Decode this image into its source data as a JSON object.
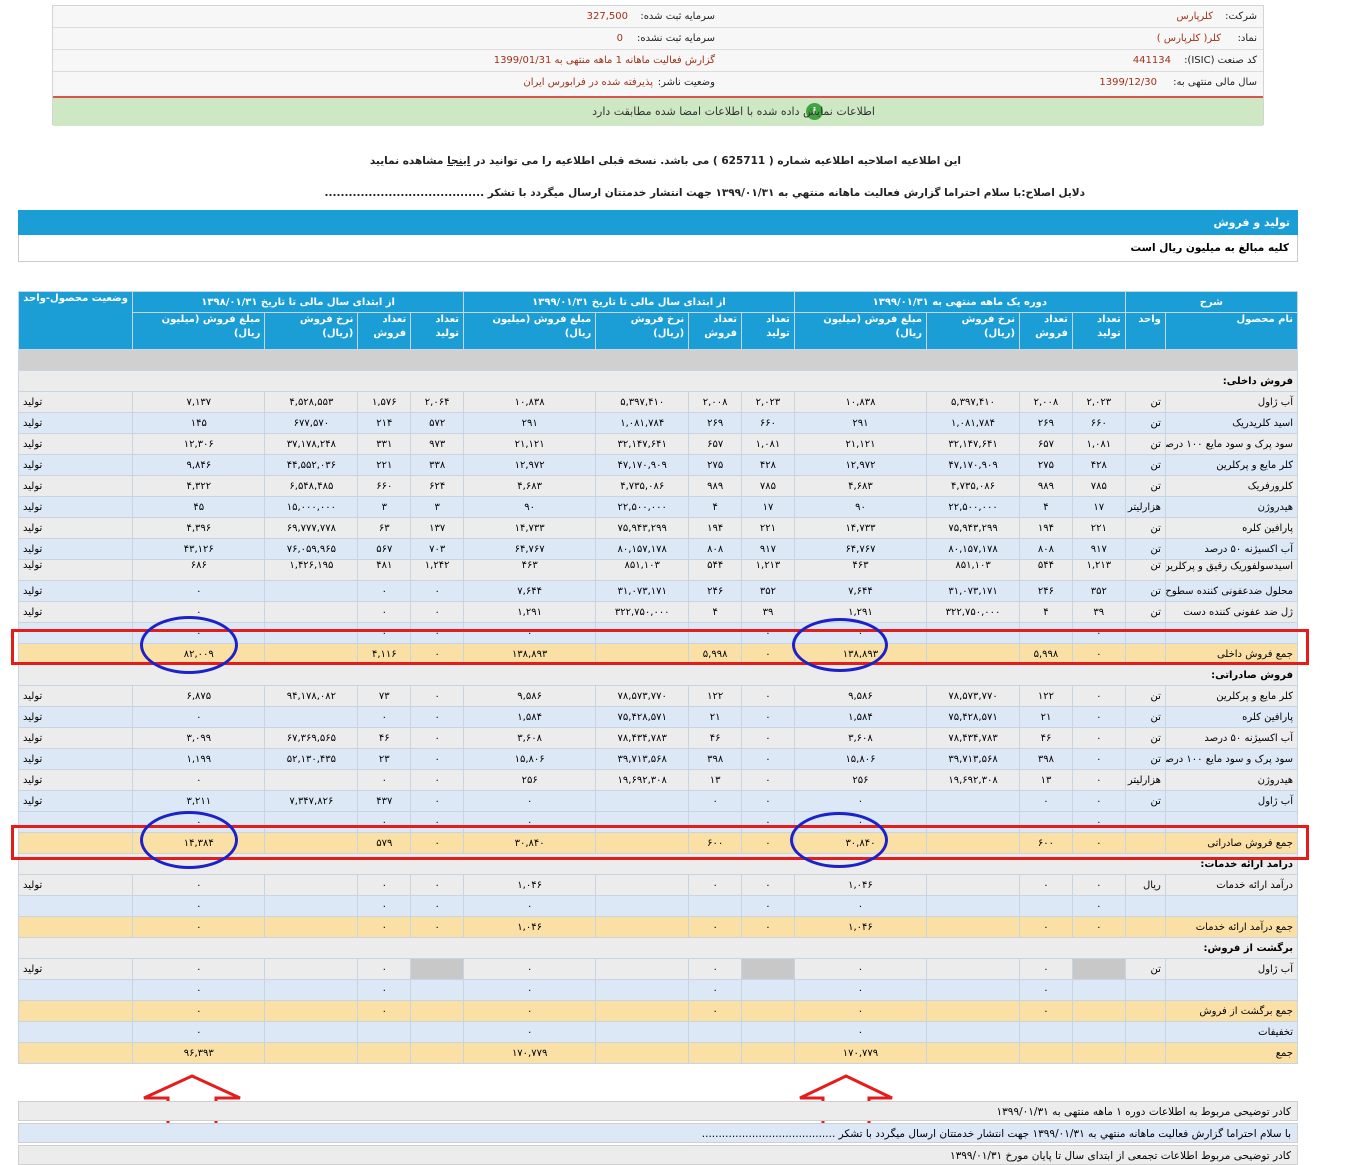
{
  "company_info": {
    "company_label": "شرکت:",
    "company_value": "کلرپارس",
    "symbol_label": "نماد:",
    "symbol_value": "کلر( کلرپارس )",
    "isic_label": "کد صنعت (ISIC):",
    "isic_value": "441134",
    "fiscal_label": "سال مالی منتهی به:",
    "fiscal_value": "1399/12/30",
    "capital_reg_label": "سرمایه ثبت شده:",
    "capital_reg_value": "327,500",
    "capital_unreg_label": "سرمایه ثبت نشده:",
    "capital_unreg_value": "0",
    "report_label": "گزارش فعالیت ماهانه 1 ماهه منتهی به 1399/01/31",
    "publisher_label": "وضعیت ناشر:",
    "publisher_value": "پذیرفته شده در فرابورس ایران",
    "notice_icon": "info-icon",
    "notice_text": "اطلاعات نمایش داده شده با اطلاعات امضا شده مطابقت دارد"
  },
  "correction": {
    "line1_pre": "این اطلاعیه اصلاحیه اطلاعیه شماره ( 625711 ) می باشد. نسخه قبلی اطلاعیه را می توانید در",
    "line1_link": "اینجا",
    "line1_post": "مشاهده نمایید",
    "line2": "دلایل اصلاح:با سلام احتراما گزارش فعالیت ماهانه منتهي به ۱۳۹۹/۰۱/۳۱ جهت انتشار خدمتتان ارسال میگردد با تشکر ........................................"
  },
  "section": {
    "title": "تولید و فروش",
    "subtitle": "کلیه مبالغ به میلیون ریال است"
  },
  "table_header": {
    "desc": "شرح",
    "period1": "دوره یک ماهه منتهی به ۱۳۹۹/۰۱/۳۱",
    "period2": "از ابتدای سال مالی تا تاریخ ۱۳۹۹/۰۱/۳۱",
    "period3": "از ابتدای سال مالی تا تاریخ ۱۳۹۸/۰۱/۳۱",
    "status": "وضعیت محصول-واحد",
    "product": "نام محصول",
    "unit": "واحد",
    "prod_qty": "تعداد تولید",
    "sale_qty": "تعداد فروش",
    "rate": "نرخ فروش (ریال)",
    "amount": "مبلغ فروش (میلیون ریال)"
  },
  "rows": [
    {
      "type": "spacer"
    },
    {
      "type": "section",
      "name": "فروش داخلی:"
    },
    {
      "type": "data",
      "name": "آب ژاول",
      "unit": "تن",
      "c": [
        "۲,۰۲۳",
        "۲,۰۰۸",
        "۵,۳۹۷,۴۱۰",
        "۱۰,۸۳۸",
        "۲,۰۲۳",
        "۲,۰۰۸",
        "۵,۳۹۷,۴۱۰",
        "۱۰,۸۳۸",
        "۲,۰۶۴",
        "۱,۵۷۶",
        "۴,۵۲۸,۵۵۳",
        "۷,۱۳۷"
      ],
      "status": "تولید"
    },
    {
      "type": "data",
      "name": "اسید کلریدریک",
      "unit": "تن",
      "c": [
        "۶۶۰",
        "۲۶۹",
        "۱,۰۸۱,۷۸۴",
        "۲۹۱",
        "۶۶۰",
        "۲۶۹",
        "۱,۰۸۱,۷۸۴",
        "۲۹۱",
        "۵۷۲",
        "۲۱۴",
        "۶۷۷,۵۷۰",
        "۱۴۵"
      ],
      "status": "تولید"
    },
    {
      "type": "data",
      "name": "سود پرک و سود مایع ۱۰۰ درصد",
      "unit": "تن",
      "c": [
        "۱,۰۸۱",
        "۶۵۷",
        "۳۲,۱۴۷,۶۴۱",
        "۲۱,۱۲۱",
        "۱,۰۸۱",
        "۶۵۷",
        "۳۲,۱۴۷,۶۴۱",
        "۲۱,۱۲۱",
        "۹۷۳",
        "۳۳۱",
        "۳۷,۱۷۸,۲۴۸",
        "۱۲,۳۰۶"
      ],
      "status": "تولید"
    },
    {
      "type": "data",
      "name": "کلر مایع و پرکلرین",
      "unit": "تن",
      "c": [
        "۴۲۸",
        "۲۷۵",
        "۴۷,۱۷۰,۹۰۹",
        "۱۲,۹۷۲",
        "۴۲۸",
        "۲۷۵",
        "۴۷,۱۷۰,۹۰۹",
        "۱۲,۹۷۲",
        "۳۳۸",
        "۲۲۱",
        "۴۴,۵۵۲,۰۳۶",
        "۹,۸۴۶"
      ],
      "status": "تولید"
    },
    {
      "type": "data",
      "name": "کلرورفریک",
      "unit": "تن",
      "c": [
        "۷۸۵",
        "۹۸۹",
        "۴,۷۳۵,۰۸۶",
        "۴,۶۸۳",
        "۷۸۵",
        "۹۸۹",
        "۴,۷۳۵,۰۸۶",
        "۴,۶۸۳",
        "۶۲۴",
        "۶۶۰",
        "۶,۵۴۸,۴۸۵",
        "۴,۳۲۲"
      ],
      "status": "تولید"
    },
    {
      "type": "data",
      "name": "هیدروژن",
      "unit": "هزارلیتر",
      "c": [
        "۱۷",
        "۴",
        "۲۲,۵۰۰,۰۰۰",
        "۹۰",
        "۱۷",
        "۴",
        "۲۲,۵۰۰,۰۰۰",
        "۹۰",
        "۳",
        "۳",
        "۱۵,۰۰۰,۰۰۰",
        "۴۵"
      ],
      "status": "تولید"
    },
    {
      "type": "data",
      "name": "پارافین کلره",
      "unit": "تن",
      "c": [
        "۲۲۱",
        "۱۹۴",
        "۷۵,۹۴۳,۲۹۹",
        "۱۴,۷۳۳",
        "۲۲۱",
        "۱۹۴",
        "۷۵,۹۴۳,۲۹۹",
        "۱۴,۷۳۳",
        "۱۳۷",
        "۶۳",
        "۶۹,۷۷۷,۷۷۸",
        "۴,۳۹۶"
      ],
      "status": "تولید"
    },
    {
      "type": "data",
      "name": "آب اکسیژنه ۵۰ درصد",
      "unit": "تن",
      "c": [
        "۹۱۷",
        "۸۰۸",
        "۸۰,۱۵۷,۱۷۸",
        "۶۴,۷۶۷",
        "۹۱۷",
        "۸۰۸",
        "۸۰,۱۵۷,۱۷۸",
        "۶۴,۷۶۷",
        "۷۰۳",
        "۵۶۷",
        "۷۶,۰۵۹,۹۶۵",
        "۴۳,۱۲۶"
      ],
      "status": "تولید"
    },
    {
      "type": "data",
      "tall": true,
      "name": "اسیدسولفوریک رقیق و پرکلرین مایع",
      "unit": "تن",
      "c": [
        "۱,۲۱۳",
        "۵۴۴",
        "۸۵۱,۱۰۳",
        "۴۶۳",
        "۱,۲۱۳",
        "۵۴۴",
        "۸۵۱,۱۰۳",
        "۴۶۳",
        "۱,۲۴۲",
        "۴۸۱",
        "۱,۴۲۶,۱۹۵",
        "۶۸۶"
      ],
      "status": "تولید"
    },
    {
      "type": "data",
      "name": "محلول ضدعفونی کننده سطوح",
      "unit": "تن",
      "c": [
        "۳۵۲",
        "۲۴۶",
        "۳۱,۰۷۳,۱۷۱",
        "۷,۶۴۴",
        "۳۵۲",
        "۲۴۶",
        "۳۱,۰۷۳,۱۷۱",
        "۷,۶۴۴",
        "۰",
        "۰",
        "",
        "۰"
      ],
      "status": "تولید"
    },
    {
      "type": "data",
      "name": "ژل ضد عفونی کننده دست",
      "unit": "تن",
      "c": [
        "۳۹",
        "۴",
        "۳۲۲,۷۵۰,۰۰۰",
        "۱,۲۹۱",
        "۳۹",
        "۴",
        "۳۲۲,۷۵۰,۰۰۰",
        "۱,۲۹۱",
        "۰",
        "۰",
        "",
        "۰"
      ],
      "status": "تولید"
    },
    {
      "type": "small",
      "c": [
        "۰",
        "",
        "",
        "۰",
        "۰",
        "",
        "",
        "۰",
        "۰",
        "۰",
        "",
        "۰"
      ]
    },
    {
      "type": "sum",
      "name": "جمع فروش داخلی",
      "c": [
        "۰",
        "۵,۹۹۸",
        "",
        "۱۳۸,۸۹۳",
        "۰",
        "۵,۹۹۸",
        "",
        "۱۳۸,۸۹۳",
        "۰",
        "۴,۱۱۶",
        "",
        "۸۲,۰۰۹"
      ]
    },
    {
      "type": "section",
      "name": "فروش صادراتی:"
    },
    {
      "type": "data",
      "name": "کلر مایع و پرکلرین",
      "unit": "تن",
      "c": [
        "۰",
        "۱۲۲",
        "۷۸,۵۷۳,۷۷۰",
        "۹,۵۸۶",
        "۰",
        "۱۲۲",
        "۷۸,۵۷۳,۷۷۰",
        "۹,۵۸۶",
        "۰",
        "۷۳",
        "۹۴,۱۷۸,۰۸۲",
        "۶,۸۷۵"
      ],
      "status": "تولید"
    },
    {
      "type": "data",
      "name": "پارافین کلره",
      "unit": "تن",
      "c": [
        "۰",
        "۲۱",
        "۷۵,۴۲۸,۵۷۱",
        "۱,۵۸۴",
        "۰",
        "۲۱",
        "۷۵,۴۲۸,۵۷۱",
        "۱,۵۸۴",
        "۰",
        "۰",
        "",
        "۰"
      ],
      "status": "تولید"
    },
    {
      "type": "data",
      "name": "آب اکسیژنه ۵۰ درصد",
      "unit": "تن",
      "c": [
        "۰",
        "۴۶",
        "۷۸,۴۳۴,۷۸۳",
        "۳,۶۰۸",
        "۰",
        "۴۶",
        "۷۸,۴۳۴,۷۸۳",
        "۳,۶۰۸",
        "۰",
        "۴۶",
        "۶۷,۳۶۹,۵۶۵",
        "۳,۰۹۹"
      ],
      "status": "تولید"
    },
    {
      "type": "data",
      "name": "سود پرک و سود مایع ۱۰۰ درصد",
      "unit": "تن",
      "c": [
        "۰",
        "۳۹۸",
        "۳۹,۷۱۳,۵۶۸",
        "۱۵,۸۰۶",
        "۰",
        "۳۹۸",
        "۳۹,۷۱۳,۵۶۸",
        "۱۵,۸۰۶",
        "۰",
        "۲۳",
        "۵۲,۱۳۰,۴۳۵",
        "۱,۱۹۹"
      ],
      "status": "تولید"
    },
    {
      "type": "data",
      "name": "هیدروژن",
      "unit": "هزارلیتر",
      "c": [
        "۰",
        "۱۳",
        "۱۹,۶۹۲,۳۰۸",
        "۲۵۶",
        "۰",
        "۱۳",
        "۱۹,۶۹۲,۳۰۸",
        "۲۵۶",
        "۰",
        "۰",
        "",
        "۰"
      ],
      "status": "تولید"
    },
    {
      "type": "data",
      "name": "آب ژاول",
      "unit": "تن",
      "c": [
        "۰",
        "۰",
        "",
        "۰",
        "۰",
        "۰",
        "",
        "۰",
        "۰",
        "۴۳۷",
        "۷,۳۴۷,۸۲۶",
        "۳,۲۱۱"
      ],
      "status": "تولید"
    },
    {
      "type": "small",
      "c": [
        "۰",
        "",
        "",
        "۰",
        "۰",
        "",
        "",
        "۰",
        "۰",
        "۰",
        "",
        "۰"
      ]
    },
    {
      "type": "sum",
      "name": "جمع فروش صادراتی",
      "c": [
        "۰",
        "۶۰۰",
        "",
        "۳۰,۸۴۰",
        "۰",
        "۶۰۰",
        "",
        "۳۰,۸۴۰",
        "۰",
        "۵۷۹",
        "",
        "۱۴,۳۸۴"
      ]
    },
    {
      "type": "section",
      "name": "درآمد ارائه خدمات:"
    },
    {
      "type": "data",
      "name": "درآمد ارائه خدمات",
      "unit": "ریال",
      "c": [
        "۰",
        "۰",
        "",
        "۱,۰۴۶",
        "۰",
        "۰",
        "",
        "۱,۰۴۶",
        "۰",
        "۰",
        "",
        "۰"
      ],
      "status": "تولید"
    },
    {
      "type": "blue",
      "c": [
        "۰",
        "",
        "",
        "۰",
        "۰",
        "",
        "",
        "۰",
        "۰",
        "۰",
        "",
        "۰"
      ]
    },
    {
      "type": "sum",
      "name": "جمع درآمد ارائه خدمات",
      "c": [
        "۰",
        "۰",
        "",
        "۱,۰۴۶",
        "۰",
        "۰",
        "",
        "۱,۰۴۶",
        "۰",
        "۰",
        "",
        "۰"
      ]
    },
    {
      "type": "section",
      "name": "برگشت از فروش:"
    },
    {
      "type": "data",
      "name": "آب ژاول",
      "unit": "تن",
      "dark": [
        0,
        4,
        8
      ],
      "c": [
        "",
        "۰",
        "",
        "۰",
        "",
        "۰",
        "",
        "۰",
        "",
        "۰",
        "",
        "۰"
      ],
      "status": "تولید"
    },
    {
      "type": "blue",
      "c": [
        "",
        "۰",
        "",
        "۰",
        "",
        "۰",
        "",
        "۰",
        "",
        "۰",
        "",
        "۰"
      ]
    },
    {
      "type": "sum",
      "name": "جمع برگشت از فروش",
      "c": [
        "",
        "۰",
        "",
        "۰",
        "",
        "۰",
        "",
        "۰",
        "",
        "۰",
        "",
        "۰"
      ]
    },
    {
      "type": "blue",
      "name": "تخفیفات",
      "c": [
        "",
        "",
        "",
        "۰",
        "",
        "",
        "",
        "۰",
        "",
        "",
        "",
        "۰"
      ]
    },
    {
      "type": "sum",
      "name": "جمع",
      "c": [
        "",
        "",
        "",
        "۱۷۰,۷۷۹",
        "",
        "",
        "",
        "۱۷۰,۷۷۹",
        "",
        "",
        "",
        "۹۶,۳۹۳"
      ]
    }
  ],
  "footer": {
    "row1": "کادر توضیحی مربوط به اطلاعات دوره ۱ ماهه منتهی به ۱۳۹۹/۰۱/۳۱",
    "row2": "با سلام احتراما گزارش فعالیت ماهانه منتهي به ۱۳۹۹/۰۱/۳۱ جهت انتشار خدمتتان ارسال میگردد با تشکر ........................................",
    "row3": "کادر توضیحی مربوط اطلاعات تجمعی از ابتدای سال تا پایان مورخ ۱۳۹۹/۰۱/۳۱"
  }
}
